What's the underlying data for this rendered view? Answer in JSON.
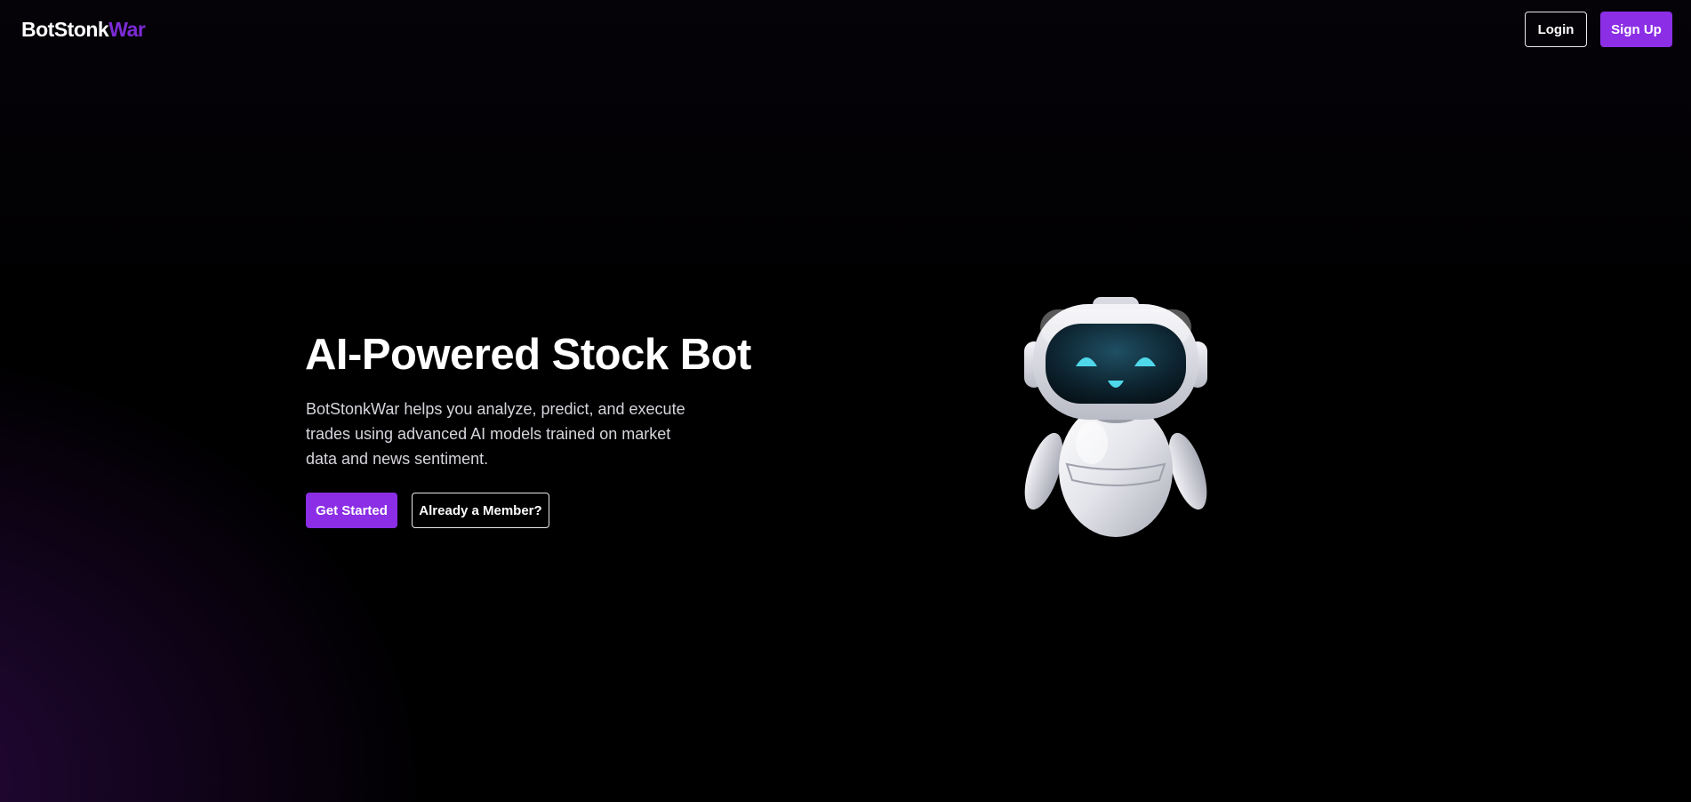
{
  "header": {
    "logo_primary": "BotStonk",
    "logo_accent": "War",
    "login_label": "Login",
    "signup_label": "Sign Up"
  },
  "hero": {
    "title": "AI-Powered Stock Bot",
    "description": "BotStonkWar helps you analyze, predict, and execute trades using advanced AI models trained on market data and news sentiment.",
    "primary_cta": "Get Started",
    "secondary_cta": "Already a Member?"
  },
  "illustration": {
    "icon": "robot-mascot-icon"
  },
  "colors": {
    "background": "#000000",
    "accent": "#8b2ee6",
    "logo_accent": "#7c2bd6",
    "text": "#ffffff",
    "muted_text": "#d7d4dc",
    "robot_eye": "#4fd8ea"
  }
}
